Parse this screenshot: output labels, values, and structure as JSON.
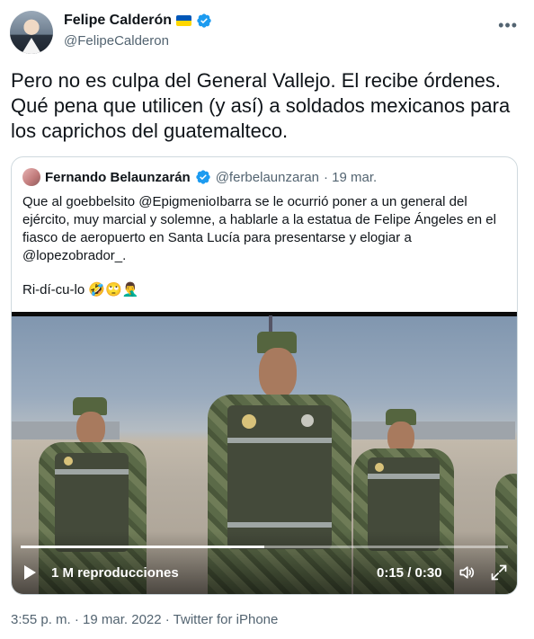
{
  "author": {
    "display_name": "Felipe Calderón",
    "handle": "@FelipeCalderon",
    "avatar_icon": "person-avatar",
    "flag_icon": "ukraine-flag-icon",
    "verified_icon": "verified-badge-icon"
  },
  "tweet": {
    "text": "Pero no es culpa del General Vallejo. El recibe órdenes. Qué pena que utilicen (y así) a soldados mexicanos para los caprichos del guatemalteco.",
    "timestamp": "3:55 p. m. · 19 mar. 2022 · Twitter for iPhone"
  },
  "quoted": {
    "display_name": "Fernando Belaunzarán",
    "handle": "@ferbelaunzaran",
    "date": "· 19 mar.",
    "text_1": "Que al goebbelsito @EpigmenioIbarra se le ocurrió poner a un general del ejército, muy marcial y solemne, a hablarle a la estatua de Felipe Ángeles en el fiasco de aeropuerto en Santa Lucía para presentarse y elogiar a @lopezobrador_.",
    "text_2": "Ri-dí-cu-lo",
    "emojis": "🤣🙄🤦‍♂️",
    "video": {
      "views": "1 M reproducciones",
      "time": "0:15 / 0:30",
      "progress": 0.5,
      "play_icon": "play-icon",
      "volume_icon": "volume-icon",
      "expand_icon": "expand-icon"
    }
  },
  "menu_icon": "more-options-icon",
  "colors": {
    "text": "#0f1419",
    "secondary": "#536471",
    "verified": "#1d9bf0",
    "border": "#cfd9de",
    "flag_blue": "#0057b7",
    "flag_yellow": "#ffd700"
  }
}
